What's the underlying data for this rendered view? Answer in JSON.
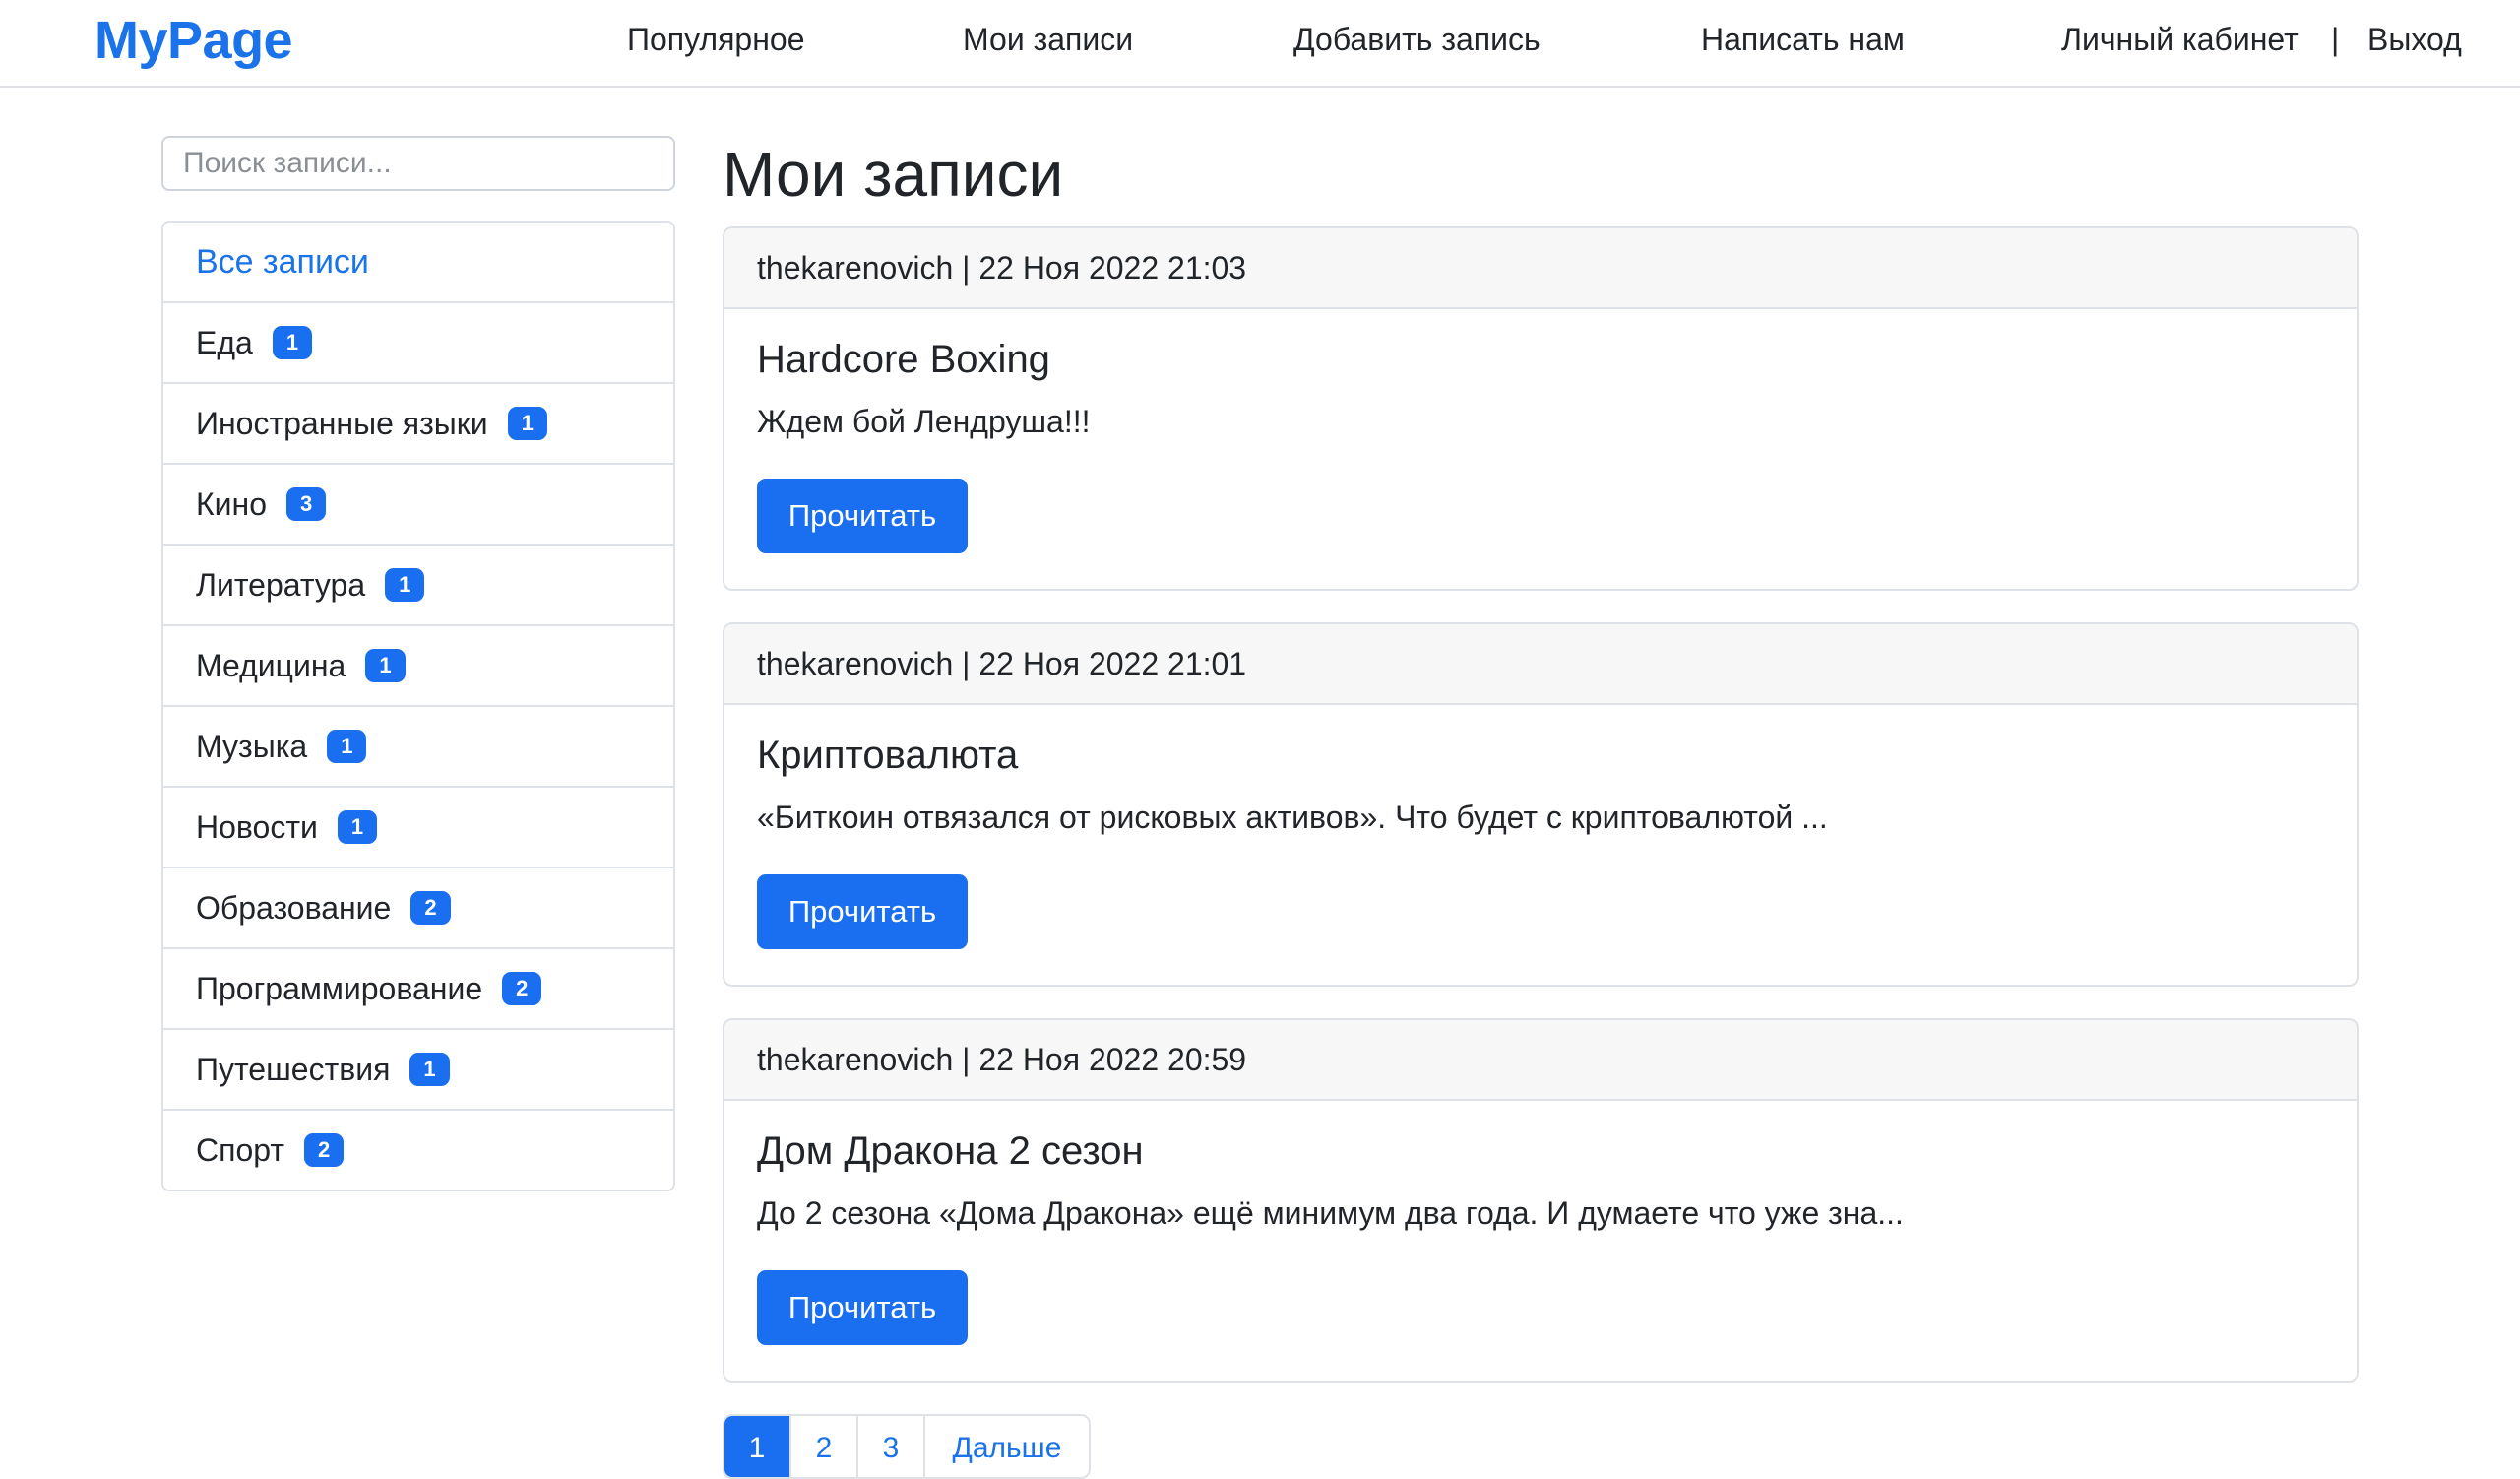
{
  "navbar": {
    "brand": "MyPage",
    "links": [
      "Популярное",
      "Мои записи",
      "Добавить запись",
      "Написать нам"
    ],
    "account": "Личный кабинет",
    "separator": "|",
    "logout": "Выход"
  },
  "sidebar": {
    "search_placeholder": "Поиск записи...",
    "all_label": "Все записи",
    "categories": [
      {
        "label": "Еда",
        "count": "1"
      },
      {
        "label": "Иностранные языки",
        "count": "1"
      },
      {
        "label": "Кино",
        "count": "3"
      },
      {
        "label": "Литература",
        "count": "1"
      },
      {
        "label": "Медицина",
        "count": "1"
      },
      {
        "label": "Музыка",
        "count": "1"
      },
      {
        "label": "Новости",
        "count": "1"
      },
      {
        "label": "Образование",
        "count": "2"
      },
      {
        "label": "Программирование",
        "count": "2"
      },
      {
        "label": "Путешествия",
        "count": "1"
      },
      {
        "label": "Спорт",
        "count": "2"
      }
    ]
  },
  "main": {
    "title": "Мои записи",
    "posts": [
      {
        "header": "thekarenovich | 22 Ноя 2022 21:03",
        "title": "Hardcore Boxing",
        "text": "Ждем бой Лендруша!!!",
        "button": "Прочитать"
      },
      {
        "header": "thekarenovich | 22 Ноя 2022 21:01",
        "title": "Криптовалюта",
        "text": "«Биткоин отвязался от рисковых активов». Что будет с криптовалютой ...",
        "button": "Прочитать"
      },
      {
        "header": "thekarenovich | 22 Ноя 2022 20:59",
        "title": "Дом Дракона 2 сезон",
        "text": "До 2 сезона «Дома Дракона» ещё минимум два года. И думаете что уже зна...",
        "button": "Прочитать"
      }
    ],
    "pagination": [
      "1",
      "2",
      "3",
      "Дальше"
    ]
  },
  "colors": {
    "accent": "#1a6ff0",
    "brand": "#1a73e8",
    "border": "#dee2e6",
    "card_header_bg": "#f7f7f7"
  }
}
